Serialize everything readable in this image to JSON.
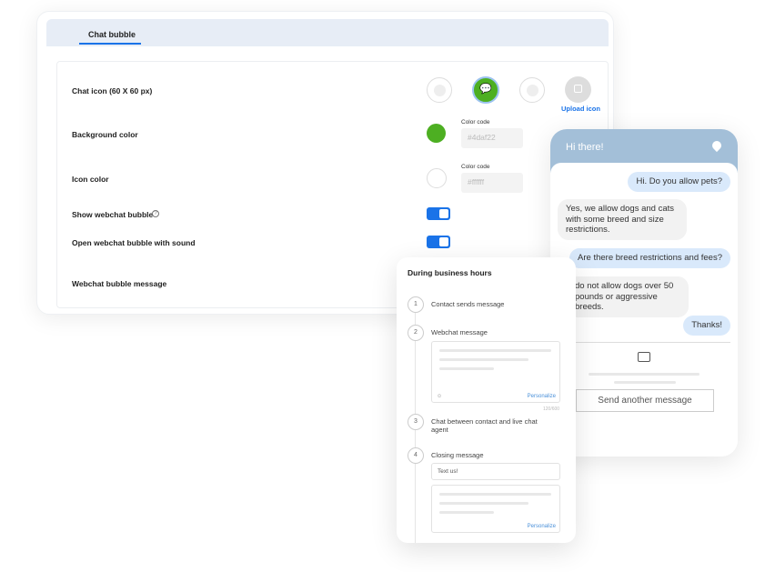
{
  "settings": {
    "tab": "Chat bubble",
    "chat_icon_label": "Chat icon (60 X 60 px)",
    "upload_icon": "Upload icon",
    "background_color_label": "Background color",
    "background_color_code_label": "Color code",
    "background_color_value": "#4daf22",
    "icon_color_label": "Icon color",
    "icon_color_code_label": "Color code",
    "icon_color_value": "#ffffff",
    "show_bubble_label": "Show webchat bubble",
    "show_bubble_on": true,
    "open_sound_label": "Open webchat bubble with sound",
    "open_sound_on": true,
    "bubble_message_label": "Webchat bubble message",
    "accent": "#1a73e8",
    "selected_icon_color": "#4daf22"
  },
  "phone": {
    "title": "Hi there!",
    "messages": [
      {
        "from": "user",
        "text": "Hi. Do you allow pets?"
      },
      {
        "from": "agent",
        "text": "Yes, we allow dogs and cats with some breed and size restrictions."
      },
      {
        "from": "user",
        "text": "Are there breed restrictions and fees?"
      },
      {
        "from": "agent",
        "text": "do not allow dogs over 50 pounds or aggressive breeds."
      },
      {
        "from": "user",
        "text": "Thanks!"
      }
    ],
    "send_another": "Send another message",
    "header_color": "#a3bfd8"
  },
  "business": {
    "title": "During business hours",
    "steps": [
      {
        "n": "1",
        "label": "Contact sends message"
      },
      {
        "n": "2",
        "label": "Webchat message"
      },
      {
        "n": "3",
        "label": "Chat between contact and live chat agent"
      },
      {
        "n": "4",
        "label": "Closing message"
      }
    ],
    "personalize": "Personalize",
    "counter": "120/600",
    "closing_value": "Text us!"
  }
}
